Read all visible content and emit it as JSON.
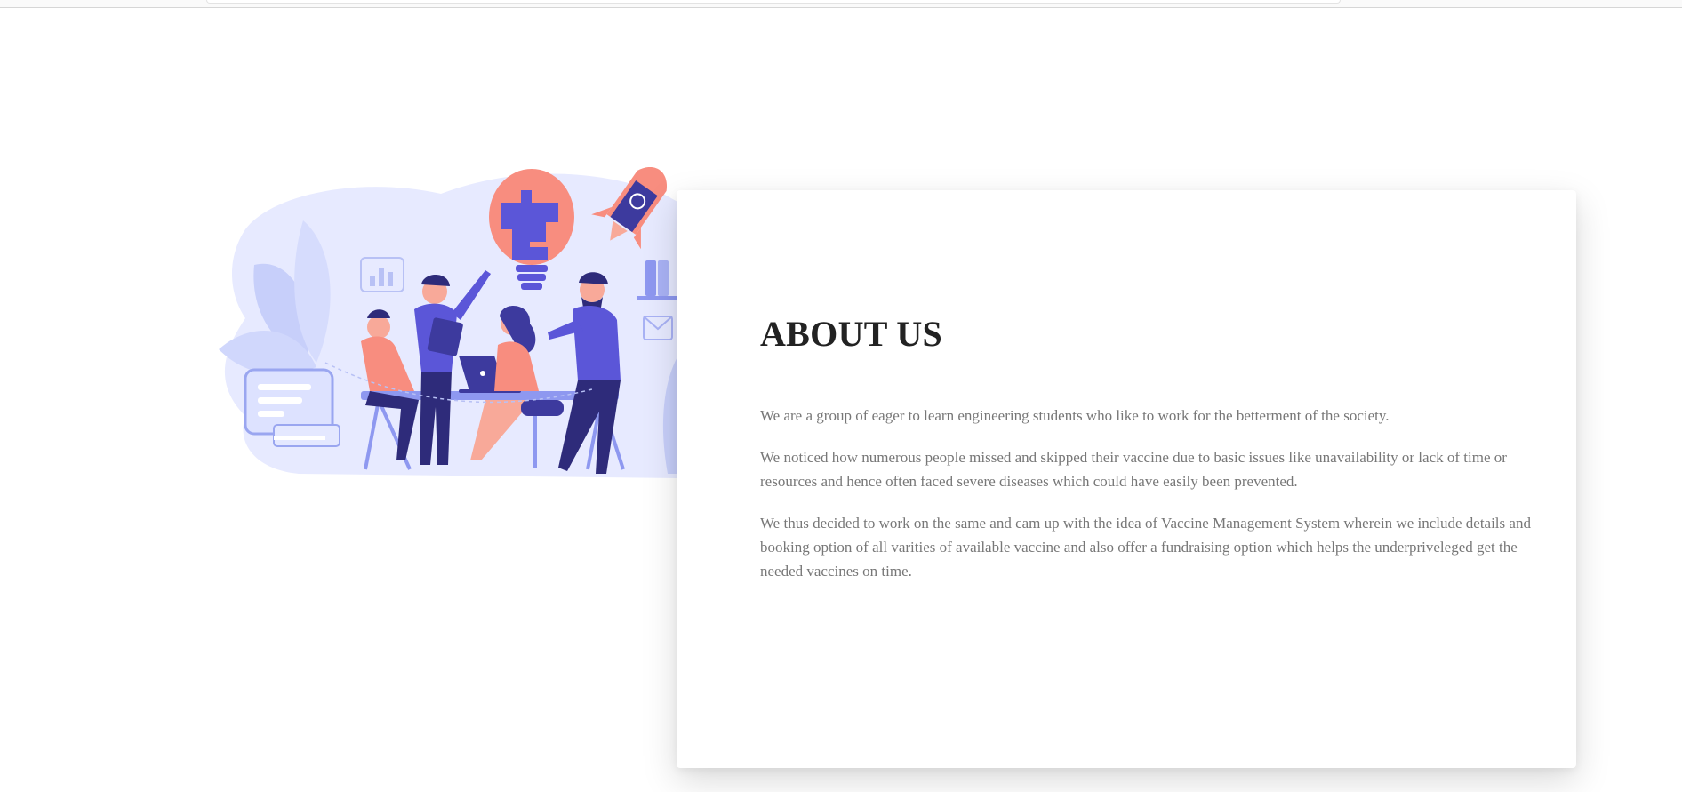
{
  "about": {
    "heading": "ABOUT US",
    "paragraphs": [
      "We are a group of eager to learn engineering students who like to work for the betterment of the society.",
      "We noticed how numerous people missed and skipped their vaccine due to basic issues like unavailability or lack of time or resources and hence often faced severe diseases which could have easily been prevented.",
      "We thus decided to work on the same and cam up with the idea of Vaccine Management System wherein we include details and booking option of all varities of available vaccine and also offer a fundraising option which helps the underpriveleged get the needed vaccines on time."
    ]
  },
  "colors": {
    "heading": "#222222",
    "body_text": "#777777",
    "illustration_purple": "#5b56d8",
    "illustration_coral": "#f88d7f",
    "illustration_light": "#dfe3ff"
  }
}
